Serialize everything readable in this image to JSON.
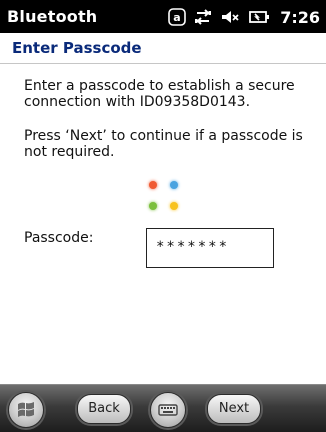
{
  "statusbar": {
    "title": "Bluetooth",
    "icons": [
      "a-in-circle-icon",
      "connectivity-arrows-icon",
      "volume-muted-icon",
      "battery-charging-icon"
    ],
    "time": "7:26"
  },
  "header": {
    "title": "Enter Passcode"
  },
  "content": {
    "instruction": "Enter a passcode to establish a secure connection with ID09358D0143.",
    "hint": "Press ‘Next’ to continue if a passcode is not required.",
    "passcode_label": "Passcode:",
    "passcode_value": "*******"
  },
  "taskbar": {
    "start_icon": "windows-start-icon",
    "back_label": "Back",
    "keyboard_icon": "keyboard-icon",
    "next_label": "Next"
  },
  "colors": {
    "header_text": "#0a2a7a",
    "statusbar_bg": "#000000",
    "logo_red": "#f05a32",
    "logo_blue": "#4aa3e0",
    "logo_green": "#7bbf3c",
    "logo_yellow": "#f8c21c"
  }
}
